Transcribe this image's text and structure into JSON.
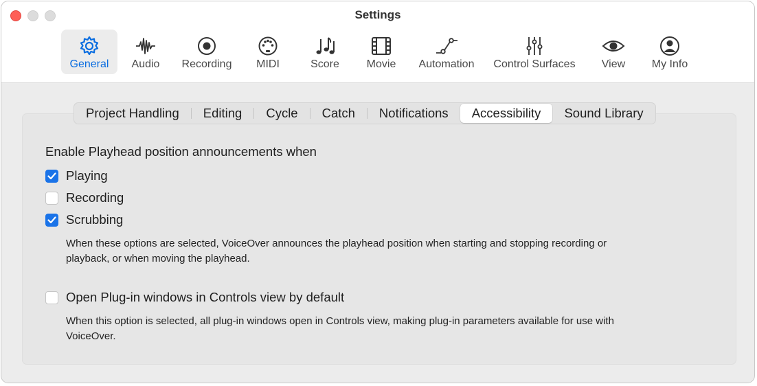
{
  "window": {
    "title": "Settings"
  },
  "toolbar": {
    "items": [
      {
        "label": "General",
        "icon": "gear-icon",
        "selected": true
      },
      {
        "label": "Audio",
        "icon": "waveform-icon"
      },
      {
        "label": "Recording",
        "icon": "record-icon"
      },
      {
        "label": "MIDI",
        "icon": "midi-icon"
      },
      {
        "label": "Score",
        "icon": "music-notes-icon"
      },
      {
        "label": "Movie",
        "icon": "film-icon"
      },
      {
        "label": "Automation",
        "icon": "automation-curve-icon"
      },
      {
        "label": "Control Surfaces",
        "icon": "sliders-icon"
      },
      {
        "label": "View",
        "icon": "eye-icon"
      },
      {
        "label": "My Info",
        "icon": "person-icon"
      }
    ]
  },
  "tabs": {
    "items": [
      "Project Handling",
      "Editing",
      "Cycle",
      "Catch",
      "Notifications",
      "Accessibility",
      "Sound Library"
    ],
    "selected": "Accessibility"
  },
  "content": {
    "heading": "Enable Playhead position announcements when",
    "options": [
      {
        "label": "Playing",
        "checked": true
      },
      {
        "label": "Recording",
        "checked": false
      },
      {
        "label": "Scrubbing",
        "checked": true
      }
    ],
    "options_description_line1": "When these options are selected, VoiceOver announces the playhead position when starting and stopping recording or",
    "options_description_line2": "playback, or when moving the playhead.",
    "plugin_option": {
      "label": "Open Plug-in windows in Controls view by default",
      "checked": false
    },
    "plugin_description_line1": "When this option is selected, all plug-in windows open in Controls view, making plug-in parameters available for use with",
    "plugin_description_line2": "VoiceOver."
  },
  "colors": {
    "accent": "#1a73e8",
    "selected_label": "#0a6de0",
    "close": "#fe5f57"
  }
}
